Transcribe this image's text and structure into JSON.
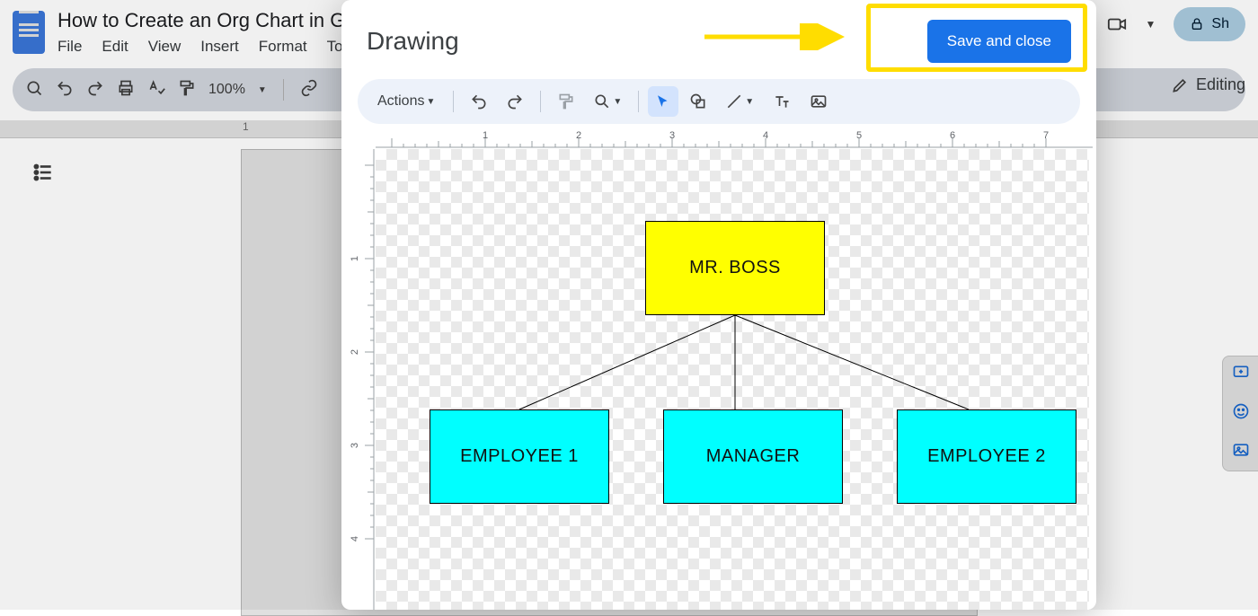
{
  "gdocs": {
    "title": "How to Create an Org Chart in Go",
    "menus": [
      "File",
      "Edit",
      "View",
      "Insert",
      "Format",
      "Tools"
    ],
    "zoom": "100%",
    "editing_label": "Editing",
    "share_label": "Sh",
    "ruler_mark": "1"
  },
  "drawing": {
    "title": "Drawing",
    "save_label": "Save and close",
    "actions_label": "Actions",
    "h_ruler_marks": [
      "1",
      "2",
      "3",
      "4",
      "5",
      "6",
      "7"
    ],
    "v_ruler_marks": [
      "1",
      "2",
      "3",
      "4"
    ]
  },
  "org_chart": {
    "boss": "MR. BOSS",
    "left": "EMPLOYEE 1",
    "mid": "MANAGER",
    "right": "EMPLOYEE 2"
  },
  "chart_data": {
    "type": "org",
    "nodes": [
      {
        "id": "boss",
        "label": "MR. BOSS",
        "color": "#ffff00",
        "row": 0
      },
      {
        "id": "emp1",
        "label": "EMPLOYEE 1",
        "color": "#00ffff",
        "row": 1
      },
      {
        "id": "mgr",
        "label": "MANAGER",
        "color": "#00ffff",
        "row": 1
      },
      {
        "id": "emp2",
        "label": "EMPLOYEE 2",
        "color": "#00ffff",
        "row": 1
      }
    ],
    "edges": [
      {
        "from": "boss",
        "to": "emp1"
      },
      {
        "from": "boss",
        "to": "mgr"
      },
      {
        "from": "boss",
        "to": "emp2"
      }
    ]
  }
}
